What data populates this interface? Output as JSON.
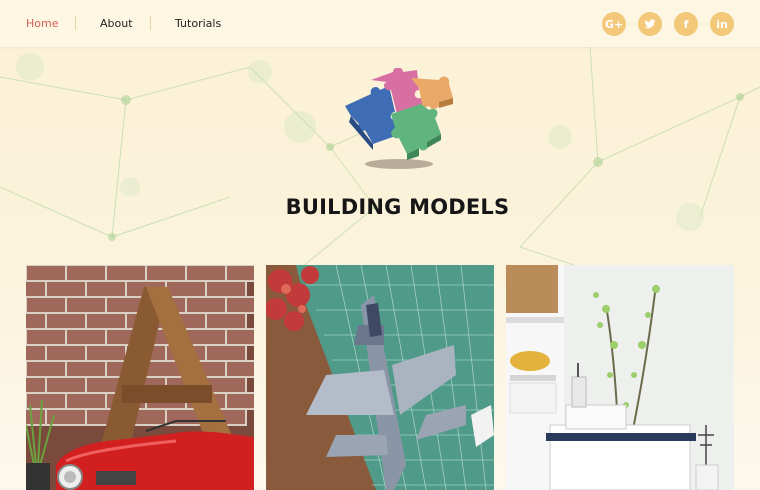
{
  "nav": {
    "items": [
      {
        "label": "Home",
        "active": true
      },
      {
        "label": "About",
        "active": false
      },
      {
        "label": "Tutorials",
        "active": false
      }
    ]
  },
  "social": [
    {
      "icon": "google-plus-icon",
      "label": "G+"
    },
    {
      "icon": "twitter-icon",
      "label": ""
    },
    {
      "icon": "facebook-icon",
      "label": "f"
    },
    {
      "icon": "linkedin-icon",
      "label": "in"
    }
  ],
  "hero": {
    "logo_icon": "puzzle-pieces-icon",
    "title": "BUILDING MODELS"
  },
  "cards": [
    {
      "image": "letter-a-and-red-toy-car"
    },
    {
      "image": "fighter-jet-model-on-cutting-mat"
    },
    {
      "image": "white-model-ship-on-shelf"
    }
  ],
  "colors": {
    "accent": "#d0605a",
    "social_button": "#f3c878",
    "background": "#fbf1d6"
  }
}
